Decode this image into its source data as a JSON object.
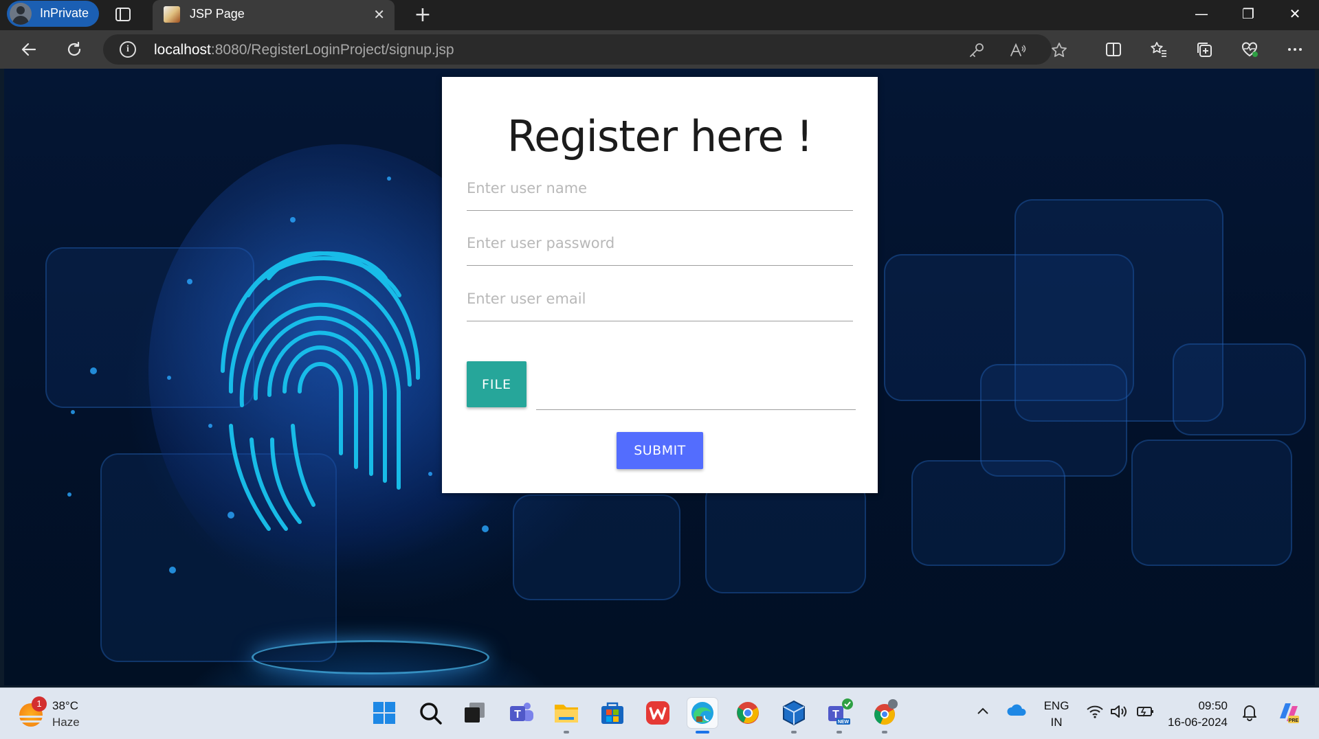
{
  "browser": {
    "profile_label": "InPrivate",
    "tab_title": "JSP Page",
    "tab_close": "✕",
    "new_tab": "+",
    "window_controls": {
      "minimize": "—",
      "restore": "❐",
      "close": "✕"
    },
    "url_host": "localhost",
    "url_rest": ":8080/RegisterLoginProject/signup.jsp",
    "icons": [
      "back-icon",
      "refresh-icon",
      "site-info-icon",
      "key-icon",
      "read-aloud-icon",
      "favorite-star-icon",
      "split-screen-icon",
      "favorites-icon",
      "collections-icon",
      "browser-essentials-icon",
      "more-icon"
    ]
  },
  "form": {
    "heading": "Register here !",
    "username_placeholder": "Enter user name",
    "password_placeholder": "Enter user password",
    "email_placeholder": "Enter user email",
    "file_button": "FILE",
    "submit_button": "SUBMIT"
  },
  "taskbar": {
    "weather_temp": "38°C",
    "weather_condition": "Haze",
    "weather_badge": "1",
    "apps": [
      "start",
      "search",
      "task-view",
      "teams",
      "file-explorer",
      "microsoft-store",
      "wps-office",
      "edge",
      "chrome",
      "virtualbox",
      "teams-new",
      "chrome-profile"
    ],
    "lang_line1": "ENG",
    "lang_line2": "IN",
    "time": "09:50",
    "date": "16-06-2024"
  },
  "colors": {
    "file_button": "#26a69a",
    "submit_button": "#536dfe",
    "inprivate_pill": "#1b5fb3"
  }
}
